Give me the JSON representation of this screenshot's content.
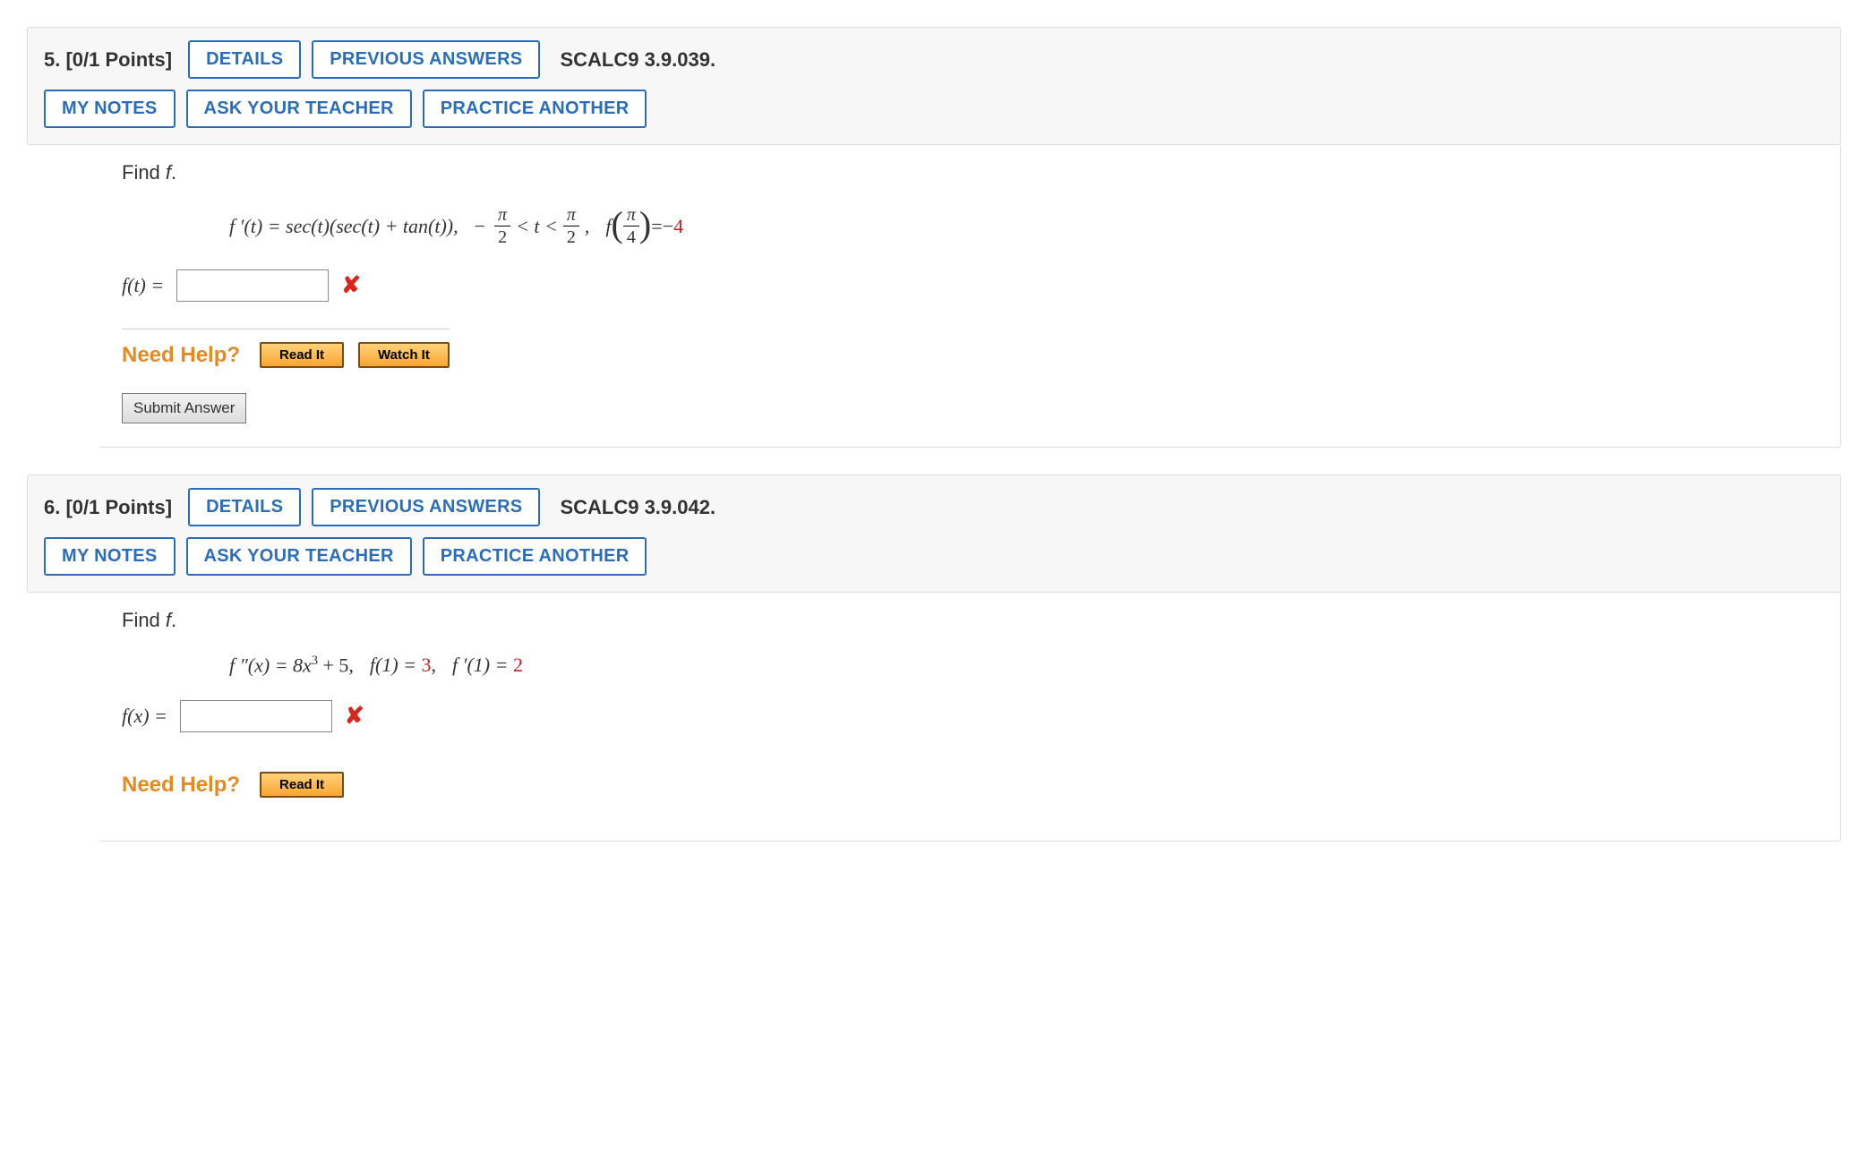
{
  "questions": [
    {
      "number": "5.",
      "points": "[0/1 Points]",
      "buttons": {
        "details": "DETAILS",
        "previous": "PREVIOUS ANSWERS",
        "mynotes": "MY NOTES",
        "ask": "ASK YOUR TEACHER",
        "practice": "PRACTICE ANOTHER"
      },
      "reference": "SCALC9 3.9.039.",
      "prompt_prefix": "Find ",
      "prompt_var": "f",
      "prompt_suffix": ".",
      "math": {
        "lhs": "f ′(t) = sec(t)(sec(t) + tan(t)),",
        "interval_prefix_neg": "−",
        "interval_frac1_num": "π",
        "interval_frac1_den": "2",
        "interval_mid": " <  t  < ",
        "interval_frac2_num": "π",
        "interval_frac2_den": "2",
        "interval_comma": ",",
        "cond_f": "f",
        "cond_arg_num": "π",
        "cond_arg_den": "4",
        "cond_eq": " = ",
        "cond_neg": "−",
        "cond_val": "4"
      },
      "answer_label": "f(t) = ",
      "answer_value": "",
      "need_help_label": "Need Help?",
      "help_buttons": {
        "read": "Read It",
        "watch": "Watch It"
      },
      "submit_label": "Submit Answer"
    },
    {
      "number": "6.",
      "points": "[0/1 Points]",
      "buttons": {
        "details": "DETAILS",
        "previous": "PREVIOUS ANSWERS",
        "mynotes": "MY NOTES",
        "ask": "ASK YOUR TEACHER",
        "practice": "PRACTICE ANOTHER"
      },
      "reference": "SCALC9 3.9.042.",
      "prompt_prefix": "Find ",
      "prompt_var": "f",
      "prompt_suffix": ".",
      "math2": {
        "eq_pre": "f ″(x) = 8x",
        "eq_sup": "3",
        "eq_post": " + 5,",
        "c1_pre": "f(1) = ",
        "c1_val": "3",
        "c1_post": ",",
        "c2_pre": "f ′(1) = ",
        "c2_val": "2"
      },
      "answer_label": "f(x) = ",
      "answer_value": "",
      "need_help_label": "Need Help?",
      "help_buttons": {
        "read": "Read It"
      }
    }
  ]
}
